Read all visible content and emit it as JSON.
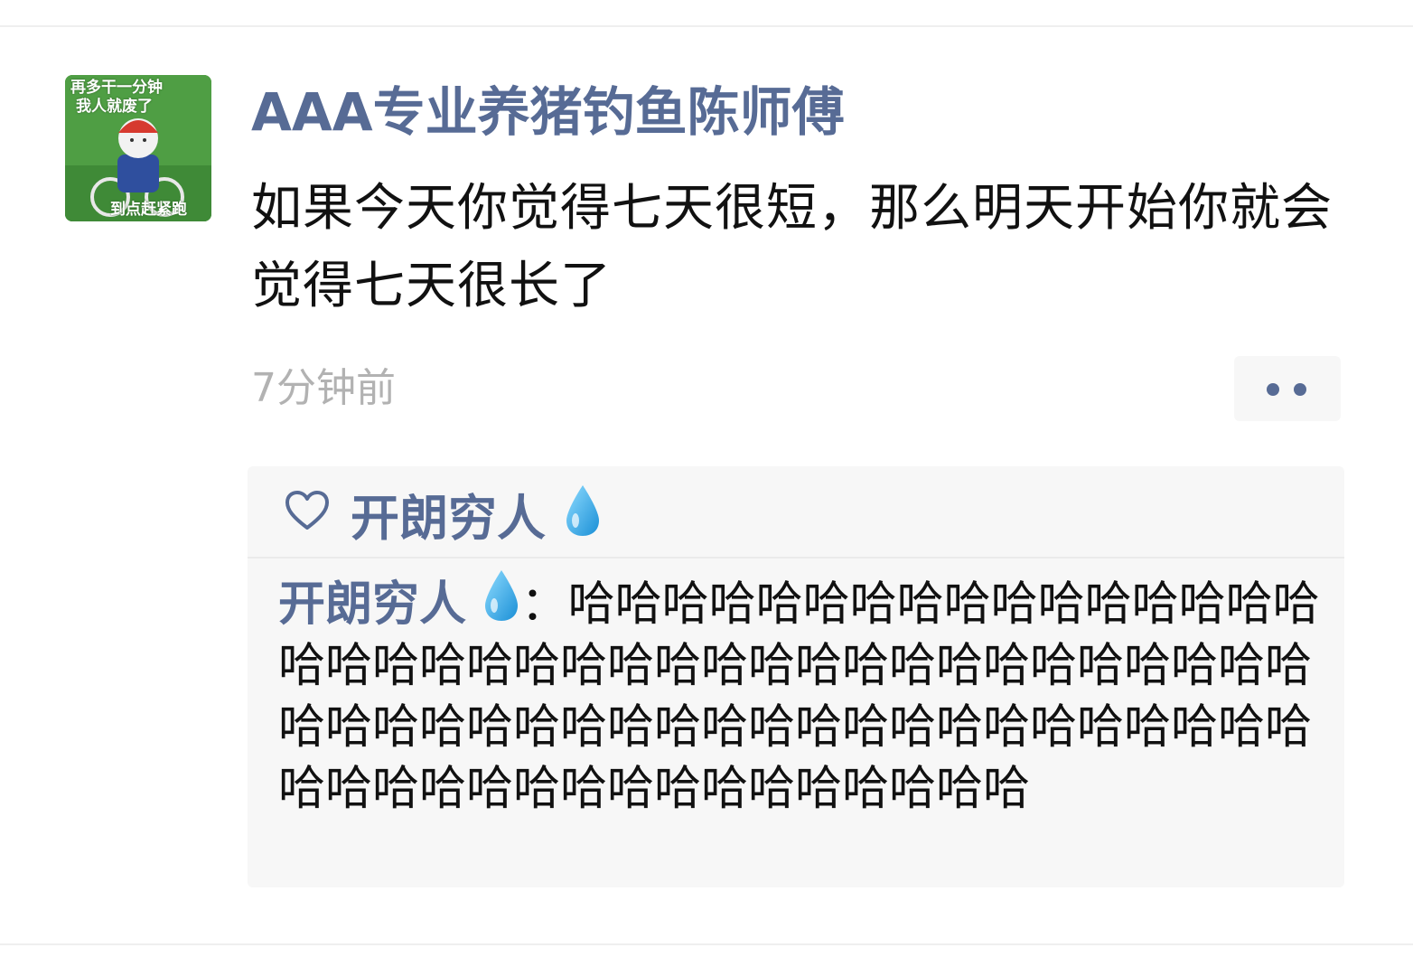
{
  "post": {
    "avatar": {
      "caption_line1": "再多干一分钟",
      "caption_line2": "我人就废了",
      "caption_line3": "到点赶紧跑"
    },
    "author": "AAA专业养猪钓鱼陈师傅",
    "body": "如果今天你觉得七天很短，那么明天开始你就会觉得七天很长了",
    "time": "7分钟前"
  },
  "likes": {
    "names": [
      "开朗穷人"
    ],
    "name_icon": "droplet-icon"
  },
  "comments": [
    {
      "author": "开朗穷人",
      "author_icon": "droplet-icon",
      "separator": "：",
      "text": "哈哈哈哈哈哈哈哈哈哈哈哈哈哈哈哈哈哈哈哈哈哈哈哈哈哈哈哈哈哈哈哈哈哈哈哈哈哈哈哈哈哈哈哈哈哈哈哈哈哈哈哈哈哈哈哈哈哈哈哈哈哈哈哈哈哈哈哈哈哈哈哈哈哈哈哈"
    }
  ],
  "colors": {
    "link_blue": "#576b95",
    "text_dark": "#111111",
    "time_gray": "#b2b2b2",
    "panel_bg": "#f7f7f7"
  }
}
